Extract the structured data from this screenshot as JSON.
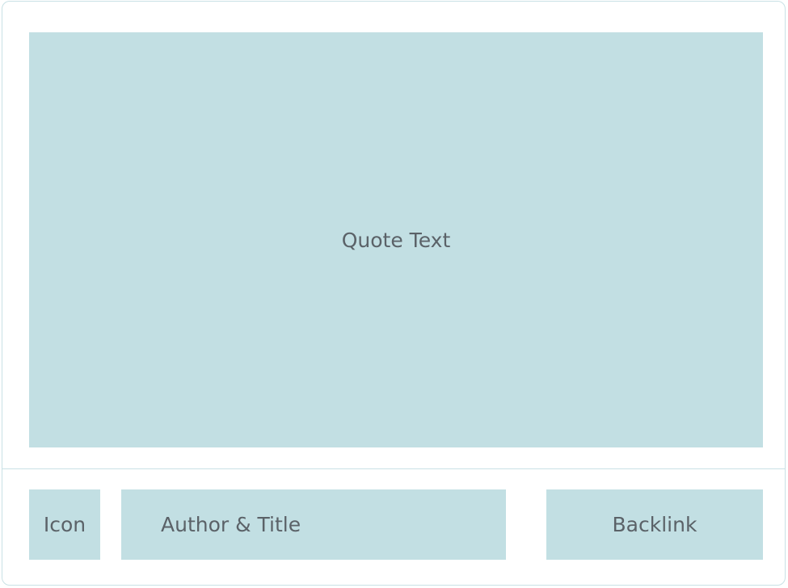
{
  "quote_block": {
    "label": "Quote Text"
  },
  "footer": {
    "icon_label": "Icon",
    "author_label": "Author & Title",
    "backlink_label": "Backlink"
  },
  "colors": {
    "block_fill": "#c2dfe3",
    "border": "#c9e1e5",
    "text": "#5b6268"
  }
}
